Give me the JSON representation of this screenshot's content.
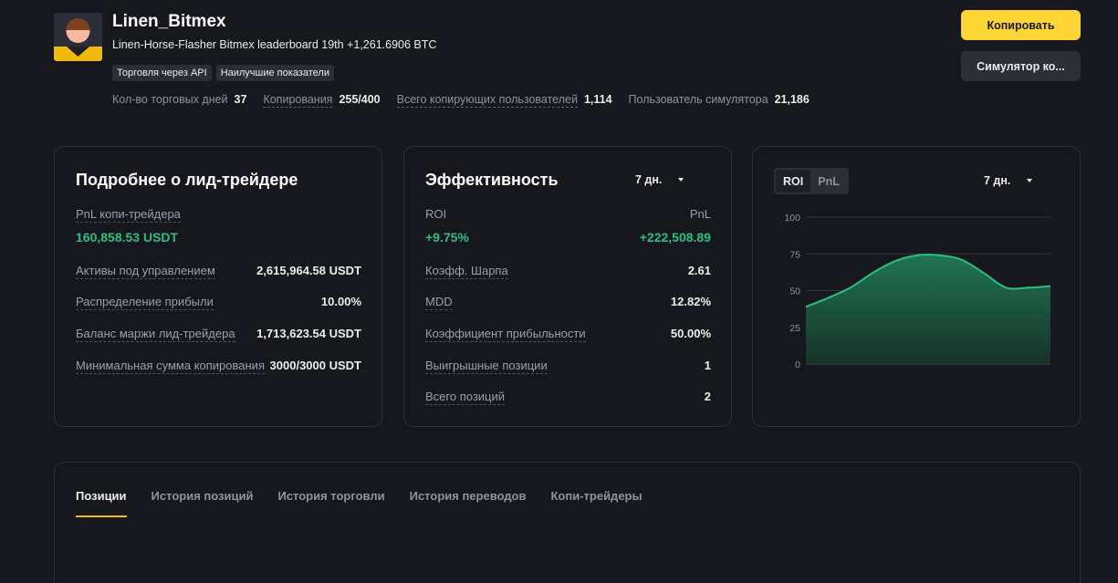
{
  "profile": {
    "name": "Linen_Bitmex",
    "description": "Linen-Horse-Flasher Bitmex leaderboard 19th +1,261.6906 BTC",
    "tags": [
      "Торговля через API",
      "Наилучшие показатели"
    ],
    "stats": [
      {
        "label": "Кол-во торговых дней",
        "value": "37"
      },
      {
        "label": "Копирования",
        "value": "255/400"
      },
      {
        "label": "Всего копирующих пользователей",
        "value": "1,114"
      },
      {
        "label": "Пользователь симулятора",
        "value": "21,186"
      }
    ]
  },
  "actions": {
    "copy_label": "Копировать",
    "simulator_label": "Симулятор ко..."
  },
  "details": {
    "title": "Подробнее о лид-трейдере",
    "copy_pnl_label": "PnL копи-трейдера",
    "copy_pnl_value": "160,858.53 USDT",
    "rows": [
      {
        "label": "Активы под управлением",
        "value": "2,615,964.58 USDT"
      },
      {
        "label": "Распределение прибыли",
        "value": "10.00%"
      },
      {
        "label": "Баланс маржи лид-трейдера",
        "value": "1,713,623.54 USDT"
      },
      {
        "label": "Минимальная сумма копирования",
        "value": "3000/3000 USDT"
      }
    ]
  },
  "performance": {
    "title": "Эффективность",
    "period": "7 дн.",
    "roi_label": "ROI",
    "roi_value": "+9.75%",
    "pnl_label": "PnL",
    "pnl_value": "+222,508.89",
    "rows": [
      {
        "label": "Коэфф. Шарпа",
        "value": "2.61"
      },
      {
        "label": "MDD",
        "value": "12.82%"
      },
      {
        "label": "Коэффициент прибыльности",
        "value": "50.00%"
      },
      {
        "label": "Выигрышные позиции",
        "value": "1"
      },
      {
        "label": "Всего позиций",
        "value": "2"
      }
    ]
  },
  "chart_panel": {
    "toggle": [
      "ROI",
      "PnL"
    ],
    "active_toggle": "ROI",
    "period": "7 дн."
  },
  "chart_data": {
    "type": "area",
    "title": "",
    "xlabel": "",
    "ylabel": "",
    "ylim": [
      0,
      100
    ],
    "yticks": [
      "100",
      "75",
      "50",
      "25",
      "0"
    ],
    "grid": true,
    "series": [
      {
        "values": [
          39,
          45,
          52,
          62,
          70,
          74,
          74,
          71,
          62,
          52,
          52,
          53
        ]
      }
    ],
    "colors": {
      "line": "#2ebd85",
      "fill_top": "#1f7a55",
      "fill_bottom": "#17352a"
    }
  },
  "tabs": {
    "items": [
      "Позиции",
      "История позиций",
      "История торговли",
      "История переводов",
      "Копи-трейдеры"
    ],
    "active": "Позиции"
  }
}
